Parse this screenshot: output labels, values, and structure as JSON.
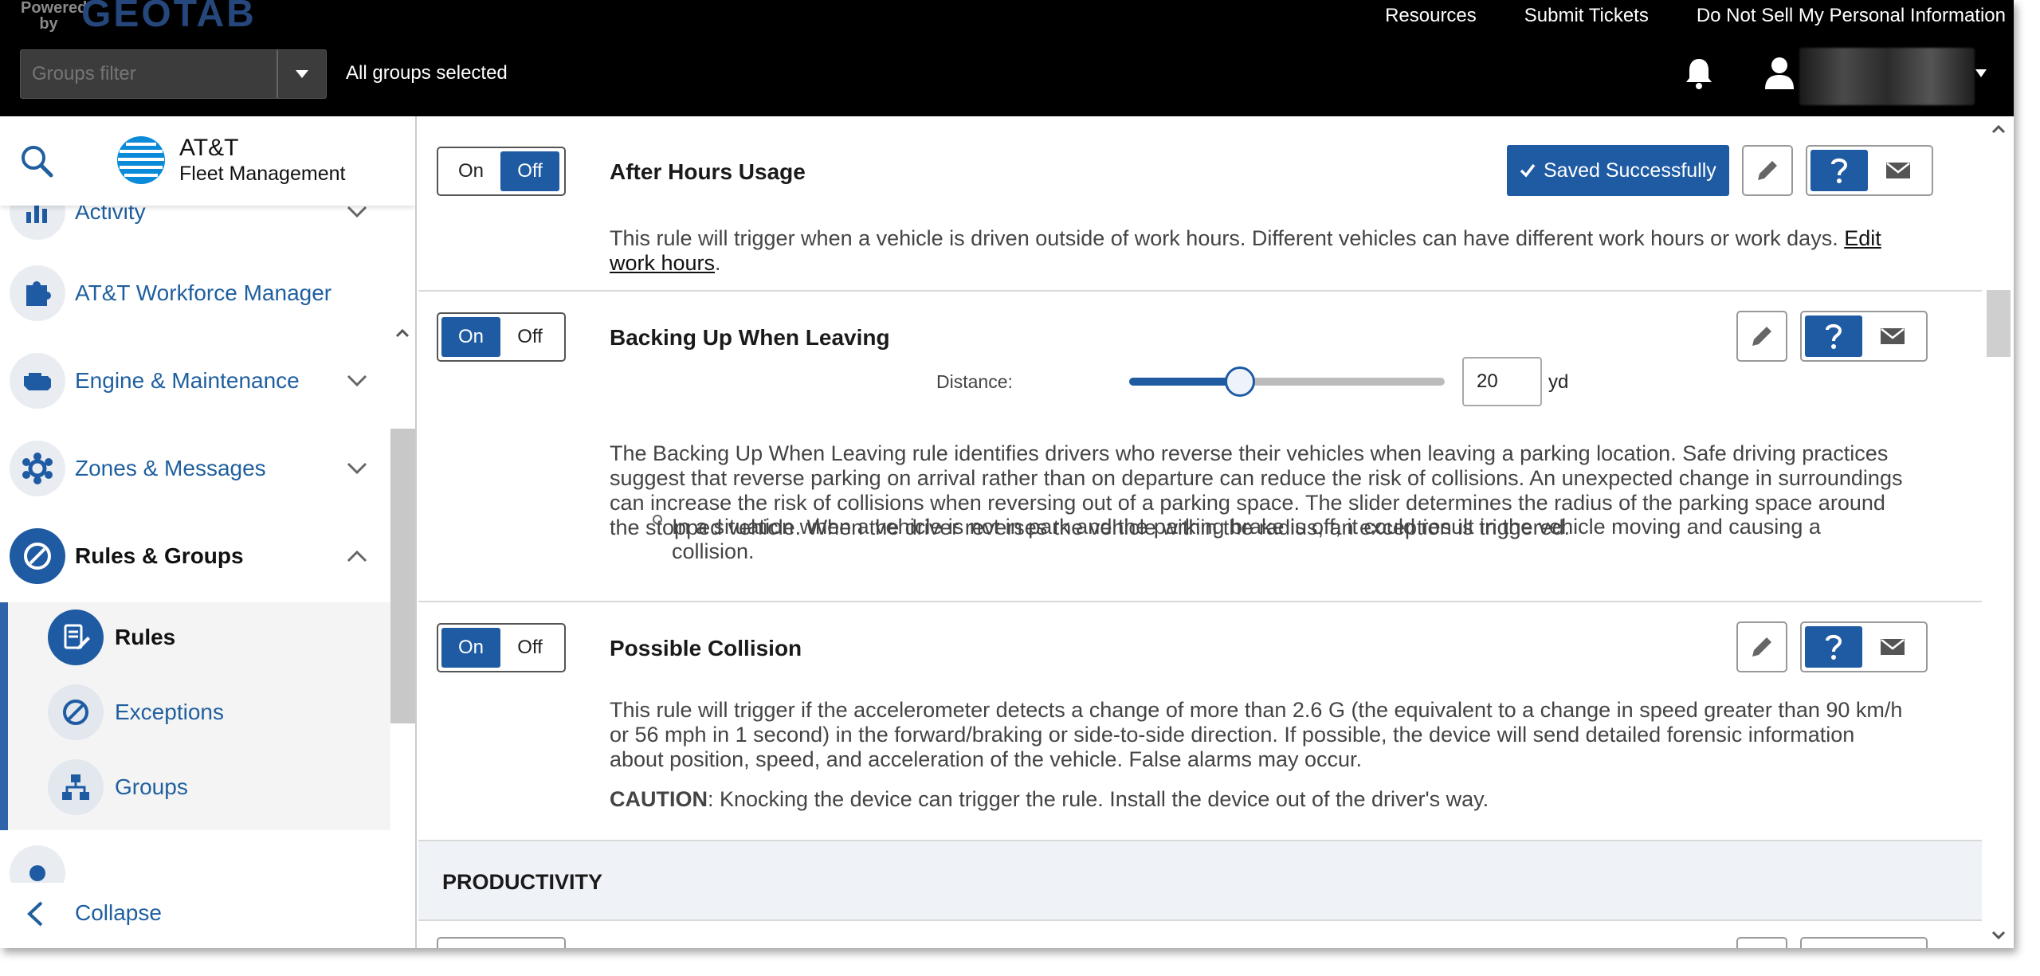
{
  "header": {
    "powered_by": "Powered by",
    "brand": "GEOTAB",
    "links": [
      "Resources",
      "Submit Tickets",
      "Do Not Sell My Personal Information"
    ],
    "groups_filter_placeholder": "Groups filter",
    "groups_selected": "All groups selected"
  },
  "sidebar": {
    "logo_name": "AT&T",
    "logo_sub": "Fleet Management",
    "items": [
      {
        "label": "Activity",
        "icon": "chart-icon"
      },
      {
        "label": "AT&T Workforce Manager",
        "icon": "puzzle-icon"
      },
      {
        "label": "Engine & Maintenance",
        "icon": "engine-icon"
      },
      {
        "label": "Zones & Messages",
        "icon": "zones-icon"
      },
      {
        "label": "Rules & Groups",
        "icon": "rules-icon"
      }
    ],
    "subitems": [
      {
        "label": "Rules",
        "icon": "rules-doc-icon"
      },
      {
        "label": "Exceptions",
        "icon": "exceptions-icon"
      },
      {
        "label": "Groups",
        "icon": "groups-icon"
      }
    ],
    "collapse_label": "Collapse"
  },
  "toggle": {
    "on": "On",
    "off": "Off"
  },
  "rules": [
    {
      "title": "After Hours Usage",
      "state": "Off",
      "saved_label": "Saved Successfully",
      "desc": "This rule will trigger when a vehicle is driven outside of work hours. Different vehicles can have different work hours or work days. ",
      "link": "Edit work hours",
      "desc_end": "."
    },
    {
      "title": "Backing Up When Leaving",
      "state": "On",
      "distance_label": "Distance:",
      "distance_value": "20",
      "distance_unit": "yd",
      "slider_fraction": 0.35,
      "desc": "The Backing Up When Leaving rule identifies drivers who reverse their vehicles when leaving a parking location. Safe driving practices suggest that reverse parking on arrival rather than on departure can reduce the risk of collisions. An unexpected change in surroundings can increase the risk of collisions when reversing out of a parking space. The slider determines the radius of the parking space around the stopped vehicle. When the driver reverses the vehicle within the radius, an exception is triggered.",
      "bullet": "In a situation when a vehicle is not in park and the parking brake is off, it could result in the vehicle moving and causing a collision."
    },
    {
      "title": "Possible Collision",
      "state": "On",
      "desc": "This rule will trigger if the accelerometer detects a change of more than 2.6 G (the equivalent to a change in speed greater than 90 km/h or 56 mph in 1 second) in the forward/braking or side-to-side direction. If possible, the device will send detailed forensic information about position, speed, and acceleration of the vehicle. False alarms may occur.",
      "caution_label": "CAUTION",
      "caution": ": Knocking the device can trigger the rule. Install the device out of the driver's way."
    }
  ],
  "section": "PRODUCTIVITY",
  "colors": {
    "accent": "#1f5ba3",
    "link": "#1f5f9f",
    "topbar": "#000000"
  }
}
